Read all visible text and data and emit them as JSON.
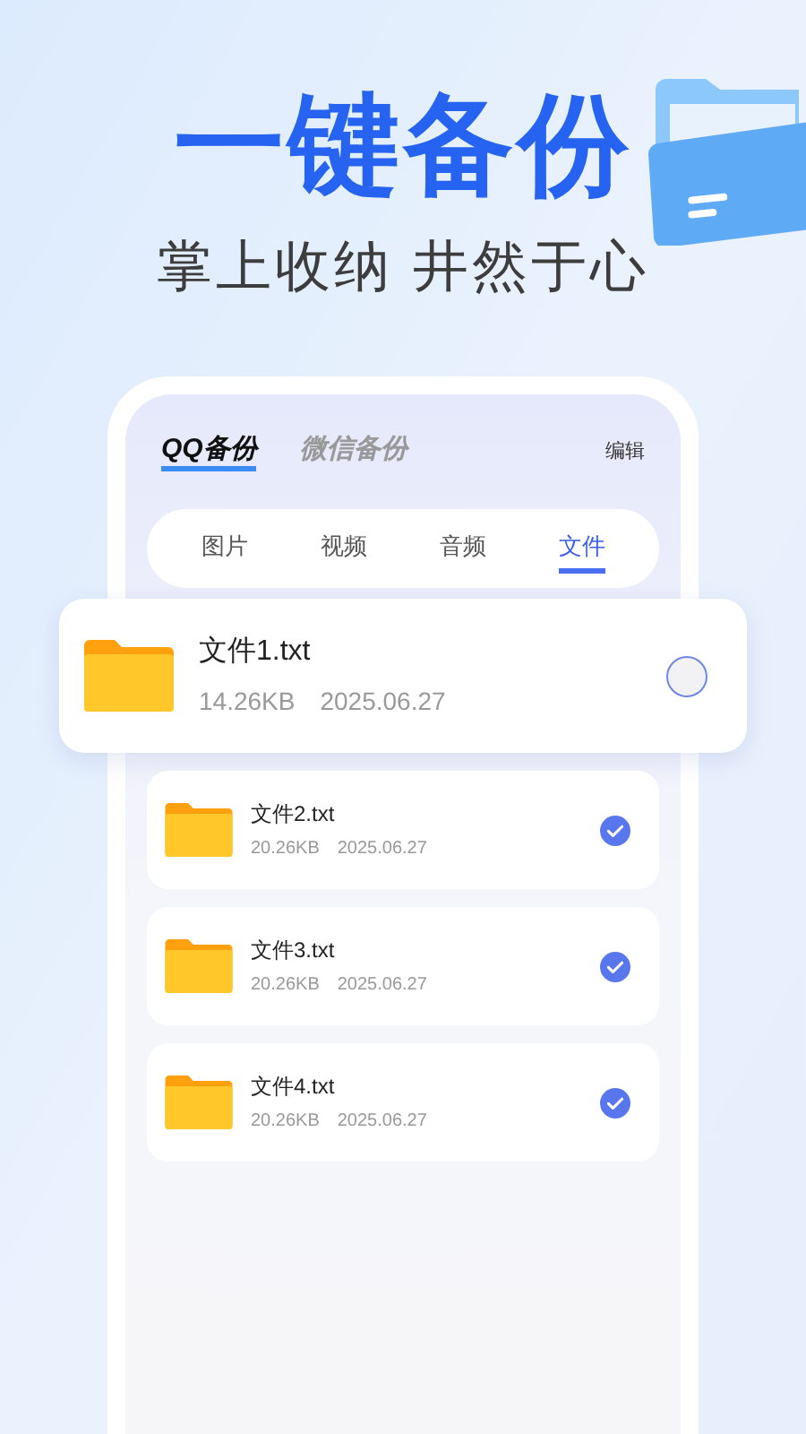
{
  "headline": "一键备份",
  "subtitle": "掌上收纳 井然于心",
  "source_tabs": [
    {
      "label": "QQ备份",
      "selected": true
    },
    {
      "label": "微信备份",
      "selected": false
    }
  ],
  "edit_link": "编辑",
  "category_tabs": [
    {
      "label": "图片",
      "selected": false
    },
    {
      "label": "视频",
      "selected": false
    },
    {
      "label": "音频",
      "selected": false
    },
    {
      "label": "文件",
      "selected": true
    }
  ],
  "files": [
    {
      "name": "文件1.txt",
      "size": "14.26KB",
      "date": "2025.06.27",
      "checked": false,
      "highlighted": true
    },
    {
      "name": "文件2.txt",
      "size": "20.26KB",
      "date": "2025.06.27",
      "checked": true,
      "highlighted": false
    },
    {
      "name": "文件3.txt",
      "size": "20.26KB",
      "date": "2025.06.27",
      "checked": true,
      "highlighted": false
    },
    {
      "name": "文件4.txt",
      "size": "20.26KB",
      "date": "2025.06.27",
      "checked": true,
      "highlighted": false
    }
  ]
}
